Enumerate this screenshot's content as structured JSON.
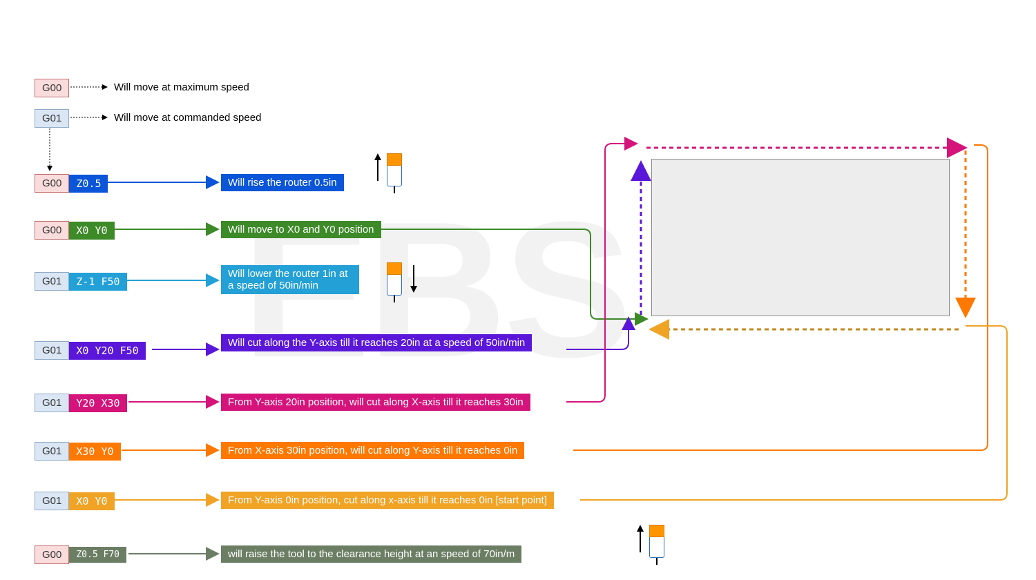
{
  "watermark": "EBS",
  "legend": {
    "g00": {
      "code": "G00",
      "text": "Will move at maximum speed"
    },
    "g01": {
      "code": "G01",
      "text": "Will move at commanded speed"
    }
  },
  "rows": [
    {
      "gcode": "G00",
      "gclass": "g00",
      "param": "Z0.5",
      "desc": "Will rise the router 0.5in",
      "color": "#0a55d8"
    },
    {
      "gcode": "G00",
      "gclass": "g00",
      "param": "X0 Y0",
      "desc": "Will move to X0 and Y0 position",
      "color": "#3d8a28"
    },
    {
      "gcode": "G01",
      "gclass": "g01",
      "param": "Z-1 F50",
      "desc": "Will lower the router 1in at a speed of 50in/min",
      "color": "#23a0d6"
    },
    {
      "gcode": "G01",
      "gclass": "g01",
      "param": "X0 Y20 F50",
      "desc": "Will cut along the Y-axis till it reaches 20in at a speed of 50in/min",
      "color": "#5b17d9"
    },
    {
      "gcode": "G01",
      "gclass": "g01",
      "param": "Y20 X30",
      "desc": "From Y-axis 20in position, will cut along X-axis till it reaches 30in",
      "color": "#d4147b"
    },
    {
      "gcode": "G01",
      "gclass": "g01",
      "param": "X30 Y0",
      "desc": "From X-axis 30in position, will cut along Y-axis till it reaches 0in",
      "color": "#ff7800"
    },
    {
      "gcode": "G01",
      "gclass": "g01",
      "param": "X0 Y0",
      "desc": "From Y-axis 0in position, cut along x-axis till it reaches 0in [start point]",
      "color": "#f0a325"
    },
    {
      "gcode": "G00",
      "gclass": "g00",
      "param": "Z0.5 F70",
      "desc": "will raise the tool to the clearance height at an speed of 70in/m",
      "color": "#6b7e64"
    }
  ]
}
